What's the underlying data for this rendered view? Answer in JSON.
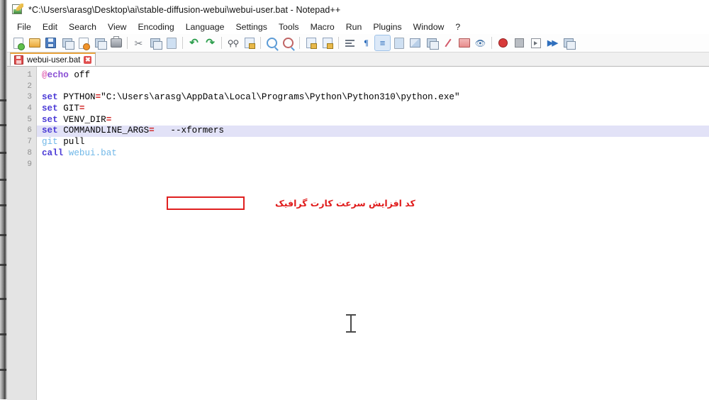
{
  "window": {
    "title": "*C:\\Users\\arasg\\Desktop\\ai\\stable-diffusion-webui\\webui-user.bat - Notepad++",
    "app_icon": "notepad-plus-plus-icon"
  },
  "menubar": {
    "items": [
      {
        "label": "File",
        "name": "menu-file"
      },
      {
        "label": "Edit",
        "name": "menu-edit"
      },
      {
        "label": "Search",
        "name": "menu-search"
      },
      {
        "label": "View",
        "name": "menu-view"
      },
      {
        "label": "Encoding",
        "name": "menu-encoding"
      },
      {
        "label": "Language",
        "name": "menu-language"
      },
      {
        "label": "Settings",
        "name": "menu-settings"
      },
      {
        "label": "Tools",
        "name": "menu-tools"
      },
      {
        "label": "Macro",
        "name": "menu-macro"
      },
      {
        "label": "Run",
        "name": "menu-run"
      },
      {
        "label": "Plugins",
        "name": "menu-plugins"
      },
      {
        "label": "Window",
        "name": "menu-window"
      },
      {
        "label": "?",
        "name": "menu-help"
      }
    ]
  },
  "toolbar": {
    "buttons": [
      {
        "icon": "new-file-icon",
        "name": "toolbar-new"
      },
      {
        "icon": "open-file-icon",
        "name": "toolbar-open"
      },
      {
        "icon": "save-icon",
        "name": "toolbar-save"
      },
      {
        "icon": "save-all-icon",
        "name": "toolbar-save-all"
      },
      {
        "icon": "close-file-icon",
        "name": "toolbar-close"
      },
      {
        "icon": "close-all-icon",
        "name": "toolbar-close-all"
      },
      {
        "icon": "print-icon",
        "name": "toolbar-print"
      },
      {
        "icon": "cut-icon",
        "name": "toolbar-cut"
      },
      {
        "icon": "copy-icon",
        "name": "toolbar-copy"
      },
      {
        "icon": "paste-icon",
        "name": "toolbar-paste"
      },
      {
        "icon": "undo-icon",
        "name": "toolbar-undo"
      },
      {
        "icon": "redo-icon",
        "name": "toolbar-redo"
      },
      {
        "icon": "find-icon",
        "name": "toolbar-find"
      },
      {
        "icon": "replace-icon",
        "name": "toolbar-replace"
      },
      {
        "icon": "zoom-in-icon",
        "name": "toolbar-zoom-in"
      },
      {
        "icon": "zoom-out-icon",
        "name": "toolbar-zoom-out"
      },
      {
        "icon": "sync-vertical-icon",
        "name": "toolbar-sync-vertical"
      },
      {
        "icon": "sync-horizontal-icon",
        "name": "toolbar-sync-horizontal"
      },
      {
        "icon": "word-wrap-icon",
        "name": "toolbar-word-wrap"
      },
      {
        "icon": "show-all-chars-icon",
        "name": "toolbar-show-all-chars"
      },
      {
        "icon": "indent-guide-icon",
        "name": "toolbar-indent-guide"
      },
      {
        "icon": "user-defined-dialog-icon",
        "name": "toolbar-udl"
      },
      {
        "icon": "document-map-icon",
        "name": "toolbar-doc-map"
      },
      {
        "icon": "function-list-icon",
        "name": "toolbar-function-list"
      },
      {
        "icon": "macro-record-pen-icon",
        "name": "toolbar-macro-pen"
      },
      {
        "icon": "folder-as-workspace-icon",
        "name": "toolbar-folder-workspace"
      },
      {
        "icon": "monitoring-eye-icon",
        "name": "toolbar-monitoring"
      },
      {
        "icon": "record-macro-icon",
        "name": "toolbar-record-macro"
      },
      {
        "icon": "stop-macro-icon",
        "name": "toolbar-stop-macro"
      },
      {
        "icon": "play-macro-icon",
        "name": "toolbar-play-macro"
      },
      {
        "icon": "run-macro-multiple-icon",
        "name": "toolbar-run-multiple"
      },
      {
        "icon": "save-macro-icon",
        "name": "toolbar-save-macro"
      }
    ]
  },
  "tabs": {
    "active": {
      "label": "webui-user.bat",
      "save_icon": "unsaved-save-icon",
      "close_icon": "close-tab-icon"
    }
  },
  "editor": {
    "line_numbers": [
      "1",
      "2",
      "3",
      "4",
      "5",
      "6",
      "7",
      "8",
      "9"
    ],
    "lines": [
      {
        "n": 1,
        "text": "@echo off"
      },
      {
        "n": 2,
        "text": ""
      },
      {
        "n": 3,
        "text": "set PYTHON=\"C:\\Users\\arasg\\AppData\\Local\\Programs\\Python\\Python310\\python.exe\""
      },
      {
        "n": 4,
        "text": "set GIT="
      },
      {
        "n": 5,
        "text": "set VENV_DIR="
      },
      {
        "n": 6,
        "text": "set COMMANDLINE_ARGS=  --xformers",
        "highlighted": true
      },
      {
        "n": 7,
        "text": "git pull"
      },
      {
        "n": 8,
        "text": "call webui.bat"
      },
      {
        "n": 9,
        "text": ""
      }
    ],
    "tokens": {
      "l1_at": "@",
      "l1_echo": "echo",
      "l1_off": " off",
      "l3_set": "set",
      "l3_var": " PYTHON",
      "l3_eq": "=",
      "l3_val": "\"C:\\Users\\arasg\\AppData\\Local\\Programs\\Python\\Python310\\python.exe\"",
      "l4_set": "set",
      "l4_var": " GIT",
      "l4_eq": "=",
      "l5_set": "set",
      "l5_var": " VENV_DIR",
      "l5_eq": "=",
      "l6_set": "set",
      "l6_var": " COMMANDLINE_ARGS",
      "l6_eq": "=",
      "l6_val": "   --xformers",
      "l7_git": "git",
      "l7_pull": " pull",
      "l8_call": "call",
      "l8_file": " webui.bat"
    }
  },
  "annotation": {
    "highlight_box_target": "--xformers",
    "note_text": "کد افزایش سرعت کارت گرافیک",
    "note_color": "#e01b1b",
    "box_color": "#e02020"
  },
  "cursor": {
    "type": "i-beam-text-cursor"
  },
  "colors": {
    "keyword": "#4b3bd6",
    "operator": "#d02020",
    "command_blue": "#6fb7e8",
    "at_symbol": "#e05fb0",
    "line_highlight": "#e2e2f7",
    "gutter_bg": "#e4e4e4",
    "tab_active_top": "#e8a33d"
  }
}
